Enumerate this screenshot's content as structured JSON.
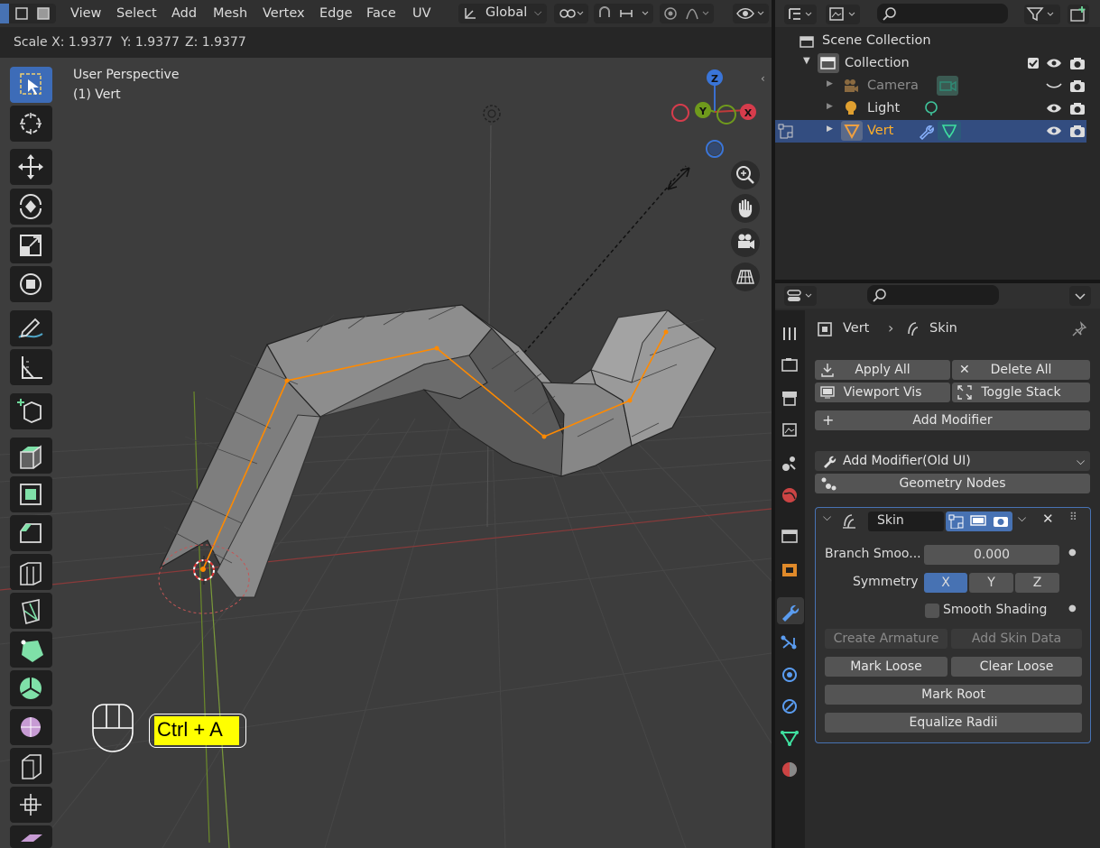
{
  "header": {
    "menus": [
      "View",
      "Select",
      "Add",
      "Mesh",
      "Vertex",
      "Edge",
      "Face",
      "UV"
    ],
    "orientation": "Global"
  },
  "operator": {
    "scale_x": "Scale X: 1.9377",
    "scale_y": "Y: 1.9377",
    "scale_z": "Z: 1.9377"
  },
  "viewport": {
    "perspective": "User Perspective",
    "selection": "(1) Vert",
    "gizmo": {
      "z": "Z",
      "y": "Y",
      "x": "X"
    }
  },
  "overlay": {
    "shortcut": "Ctrl + A"
  },
  "outliner": {
    "rows": [
      {
        "label": "Scene Collection"
      },
      {
        "label": "Collection"
      },
      {
        "label": "Camera"
      },
      {
        "label": "Light"
      },
      {
        "label": "Vert"
      }
    ]
  },
  "properties": {
    "breadcrumb_object": "Vert",
    "breadcrumb_modifier": "Skin",
    "buttons": {
      "apply_all": "Apply All",
      "delete_all": "Delete All",
      "viewport_vis": "Viewport Vis",
      "toggle_stack": "Toggle Stack",
      "add_modifier": "Add Modifier",
      "add_modifier_old": "Add Modifier(Old UI)",
      "geometry_nodes": "Geometry Nodes"
    },
    "skin": {
      "name": "Skin",
      "branch_label": "Branch Smoo...",
      "branch_value": "0.000",
      "symmetry_label": "Symmetry",
      "sym_x": "X",
      "sym_y": "Y",
      "sym_z": "Z",
      "smooth_shading": "Smooth Shading",
      "create_armature": "Create Armature",
      "add_skin_data": "Add Skin Data",
      "mark_loose": "Mark Loose",
      "clear_loose": "Clear Loose",
      "mark_root": "Mark Root",
      "equalize_radii": "Equalize Radii"
    }
  },
  "colors": {
    "accent": "#4772b3",
    "edge_select": "#ff8a00",
    "overlay_key": "#ffff00"
  }
}
